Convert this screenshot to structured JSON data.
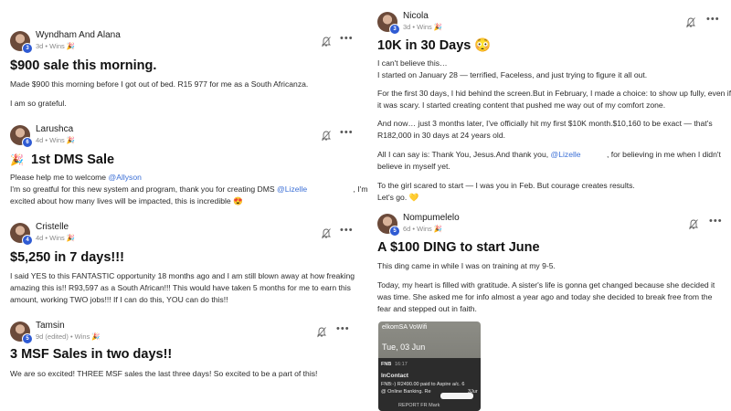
{
  "colors": {
    "link": "#3b6fd6",
    "badge": "#2f5bd3"
  },
  "posts": [
    {
      "username": "Wyndham And Alana",
      "level": "3",
      "meta": "3d • Wins 🎉",
      "title": "$900 sale this morning.",
      "body": [
        "Made $900 this morning before I got out of bed. R15 977 for me as a South Africanza.",
        "I am so grateful."
      ]
    },
    {
      "username": "Larushca",
      "level": "6",
      "meta": "4d • Wins 🎉",
      "title_prefix": "🎉",
      "title": "1st DMS Sale",
      "body": [
        "Please help me to welcome",
        "@Allyson",
        "I'm so greatful for this new system and program, thank you for creating DMS",
        "@Lizelle",
        ", I'm",
        "excited about how many lives will be impacted, this is incredible 😍"
      ]
    },
    {
      "username": "Cristelle",
      "level": "4",
      "meta": "4d • Wins 🎉",
      "title": "$5,250 in 7 days!!!",
      "body": [
        "I said YES to this FANTASTIC opportunity 18 months ago and I am still blown away at how freaking",
        "amazing this is!! R93,597 as a South African!!! This would have taken 5 months for me to earn this",
        "amount, working TWO jobs!!! If I can do this, YOU can do this!!"
      ]
    },
    {
      "username": "Tamsin",
      "level": "5",
      "meta": "9d (edited) • Wins 🎉",
      "title": "3 MSF Sales in two days!!",
      "body": [
        "We are so excited! THREE MSF sales the last three days! So excited to be a part of this!"
      ]
    },
    {
      "username": "Nicola",
      "level": "3",
      "meta": "3d • Wins 🎉",
      "title": "10K in 30 Days 😳",
      "body": [
        "I can't believe this…",
        "I started on January 28 — terrified, Faceless, and just trying to figure it all out.",
        "For the first 30 days, I hid behind the screen.But in February, I made a choice: to show up fully, even if",
        "it was scary. I started creating content that pushed me way out of my comfort zone.",
        "And now… just 3 months later, I've officially hit my first $10K month.$10,160 to be exact — that's",
        "R182,000 in 30 days at 24 years old.",
        "All I can say is: Thank You, Jesus.And thank you,",
        "@Lizelle",
        ", for believing in me when I didn't",
        "believe in myself yet.",
        "To the girl scared to start — I was you in Feb. But courage creates results.",
        "Let's go. 💛"
      ]
    },
    {
      "username": "Nompumelelo",
      "level": "5",
      "meta": "6d • Wins 🎉",
      "title": "A $100 DING to start June",
      "body": [
        "This ding came in while I was on training at my 9-5.",
        "Today, my heart is filled with gratitude. A sister's life is gonna get changed because she decided it",
        "was time. She asked me for info almost a year ago and today she decided to break free from the",
        "fear and stepped out in faith."
      ],
      "screenshot": {
        "status": "elkomSA VoWifi",
        "date": "Tue, 03 Jun",
        "bank": "FNB",
        "time": "16:17",
        "app": "InContact",
        "line1": "FNB:-) R2490.00 paid to Aspire a/c. 6",
        "line2": "@ Online Banking. Re",
        "line3": "3Jur",
        "footer": "REPORT FR    Mark"
      }
    }
  ]
}
